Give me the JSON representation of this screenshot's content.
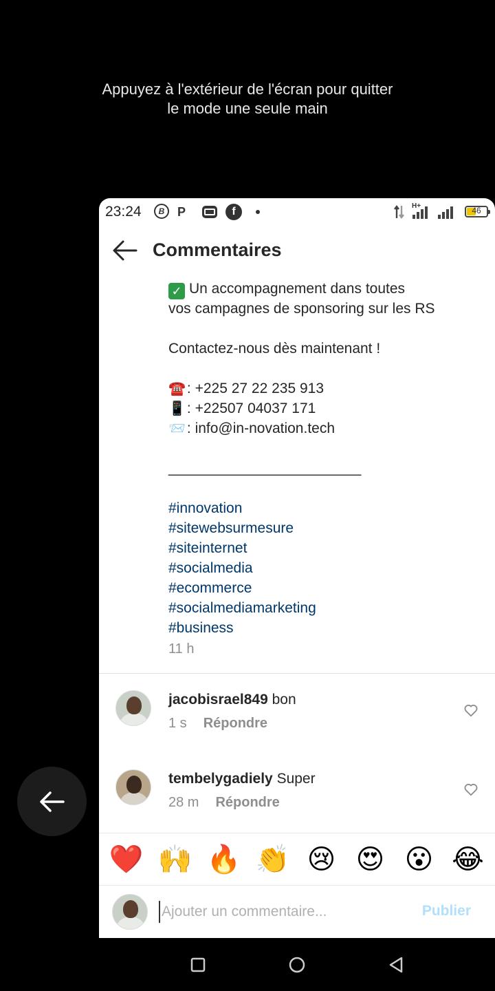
{
  "overlay": {
    "hint_line1": "Appuyez à l'extérieur de l'écran pour quitter",
    "hint_line2": "le mode une seule main"
  },
  "status_bar": {
    "time": "23:24",
    "icons": [
      "b-circle-icon",
      "p-icon",
      "gamepad-icon",
      "facebook-icon",
      "dot-icon"
    ],
    "right_icons": [
      "data-transfer-icon",
      "signal-h-plus-icon",
      "signal-icon",
      "battery-icon"
    ],
    "network_tag": "H+",
    "battery_level": "46"
  },
  "header": {
    "title": "Commentaires"
  },
  "caption": {
    "line1": "Un accompagnement dans toutes",
    "line2": "vos campagnes de sponsoring sur les RS",
    "contact": "Contactez-nous dès maintenant !",
    "phone1": ": +225 27 22 235 913",
    "phone2": ": +22507 04037 171",
    "email": ": info@in-novation.tech",
    "separator": "________________________",
    "hashtags": [
      "#innovation",
      "#sitewebsurmesure",
      "#siteinternet",
      "#socialmedia",
      "#ecommerce",
      "#socialmediamarketing",
      "#business"
    ],
    "time": "11 h"
  },
  "comments": [
    {
      "username": "jacobisrael849",
      "text": " bon",
      "time": "1 s",
      "reply_label": "Répondre"
    },
    {
      "username": "tembelygadiely",
      "text": " Super",
      "time": "28 m",
      "reply_label": "Répondre"
    }
  ],
  "reactions": [
    "❤️",
    "🙌",
    "🔥",
    "👏",
    "😢",
    "😍",
    "😮",
    "😂"
  ],
  "compose": {
    "placeholder": "Ajouter un commentaire...",
    "publish_label": "Publier"
  },
  "colors": {
    "hashtag": "#00376b",
    "muted": "#8e8e8e",
    "publish_disabled": "#b2dffc"
  }
}
